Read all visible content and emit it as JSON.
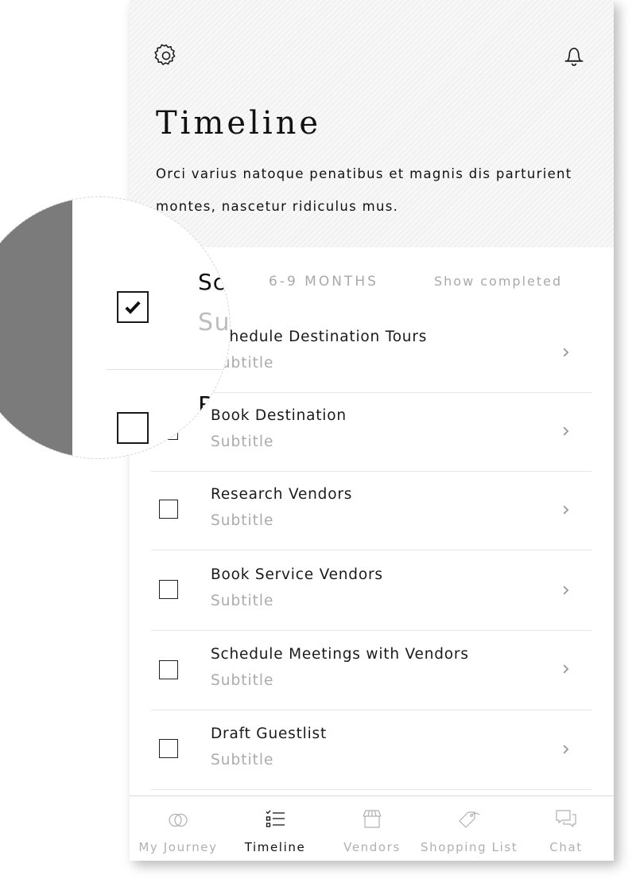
{
  "header": {
    "title": "Timeline",
    "description": "Orci varius natoque penatibus et magnis dis parturient montes, nascetur ridiculus mus.",
    "settings_icon": "gear-icon",
    "notifications_icon": "bell-icon"
  },
  "section": {
    "label": "6-9 MONTHS",
    "show_completed_label": "Show completed"
  },
  "tasks": [
    {
      "title": "Schedule Destination Tours",
      "subtitle": "Subtitle",
      "checked": true
    },
    {
      "title": "Book Destination",
      "subtitle": "Subtitle",
      "checked": false
    },
    {
      "title": "Research Vendors",
      "subtitle": "Subtitle",
      "checked": false
    },
    {
      "title": "Book Service Vendors",
      "subtitle": "Subtitle",
      "checked": false
    },
    {
      "title": "Schedule Meetings with Vendors",
      "subtitle": "Subtitle",
      "checked": false
    },
    {
      "title": "Draft Guestlist",
      "subtitle": "Subtitle",
      "checked": false
    }
  ],
  "tabs": [
    {
      "label": "My Journey",
      "icon": "rings-icon",
      "active": false
    },
    {
      "label": "Timeline",
      "icon": "checklist-icon",
      "active": true
    },
    {
      "label": "Vendors",
      "icon": "storefront-icon",
      "active": false
    },
    {
      "label": "Shopping List",
      "icon": "tag-icon",
      "active": false
    },
    {
      "label": "Chat",
      "icon": "chat-bubbles-icon",
      "active": false
    }
  ],
  "magnifier": {
    "title_fragment_1": "Sche",
    "subtitle_fragment": "Subt",
    "title_fragment_2": "Bo"
  },
  "colors": {
    "header_bg": "#f2f2f2",
    "muted_text": "#a9a9a9",
    "divider": "#e6e6e6",
    "magnifier_dark": "#7b7b7b"
  }
}
